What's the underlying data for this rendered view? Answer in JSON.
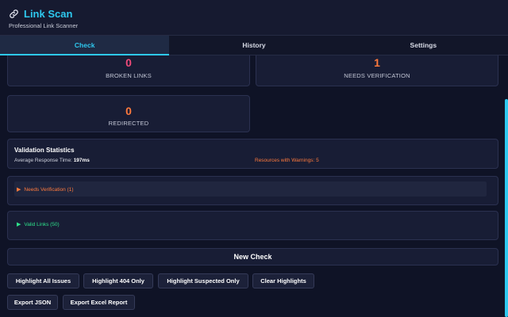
{
  "header": {
    "title": "Link Scan",
    "subtitle": "Professional Link Scanner",
    "icon": "link-icon"
  },
  "tabs": [
    {
      "label": "Check",
      "active": true
    },
    {
      "label": "History",
      "active": false
    },
    {
      "label": "Settings",
      "active": false
    }
  ],
  "stats": {
    "broken": {
      "value": "0",
      "label": "BROKEN LINKS"
    },
    "verification": {
      "value": "1",
      "label": "NEEDS VERIFICATION"
    },
    "redirected": {
      "value": "0",
      "label": "REDIRECTED"
    }
  },
  "validation": {
    "title": "Validation Statistics",
    "avg_label": "Average Response Time:",
    "avg_value": "197ms",
    "warnings_text": "Resources with Warnings: 5"
  },
  "sections": {
    "needs_verification": "Needs Verification (1)",
    "valid_links": "Valid Links (50)"
  },
  "actions": {
    "new_check": "New Check",
    "highlight_all": "Highlight All Issues",
    "highlight_404": "Highlight 404 Only",
    "highlight_suspected": "Highlight Suspected Only",
    "clear_highlights": "Clear Highlights",
    "export_json": "Export JSON",
    "export_excel": "Export Excel Report"
  },
  "colors": {
    "accent": "#2ec9ef",
    "broken": "#f04a7a",
    "warning": "#ff7a3d",
    "valid": "#2ee08a"
  }
}
